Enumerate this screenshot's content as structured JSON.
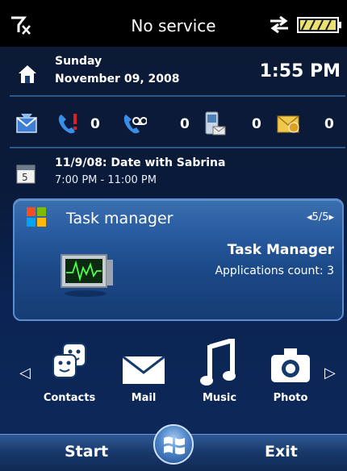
{
  "status": {
    "service_text": "No service"
  },
  "home": {
    "day": "Sunday",
    "date": "November 09, 2008",
    "time": "1:55 PM"
  },
  "notifications": [
    {
      "icon": "missed-call-icon",
      "count": "0"
    },
    {
      "icon": "voicemail-icon",
      "count": "0"
    },
    {
      "icon": "sms-icon",
      "count": "0"
    },
    {
      "icon": "email-icon",
      "count": "0"
    }
  ],
  "appointment": {
    "title": "11/9/08: Date with Sabrina",
    "times": "7:00 PM - 11:00 PM"
  },
  "taskcard": {
    "title": "Task manager",
    "pager": "◂5/5▸",
    "app_name": "Task Manager",
    "app_count": "Applications count: 3"
  },
  "launcher": {
    "apps": [
      {
        "label": "Contacts",
        "icon": "contacts-icon"
      },
      {
        "label": "Mail",
        "icon": "mail-icon"
      },
      {
        "label": "Music",
        "icon": "music-icon"
      },
      {
        "label": "Photo",
        "icon": "camera-icon"
      }
    ]
  },
  "softkeys": {
    "left": "Start",
    "right": "Exit"
  },
  "colors": {
    "accent": "#2e5788",
    "card": "#275a9e",
    "battery": "#e8e070"
  }
}
